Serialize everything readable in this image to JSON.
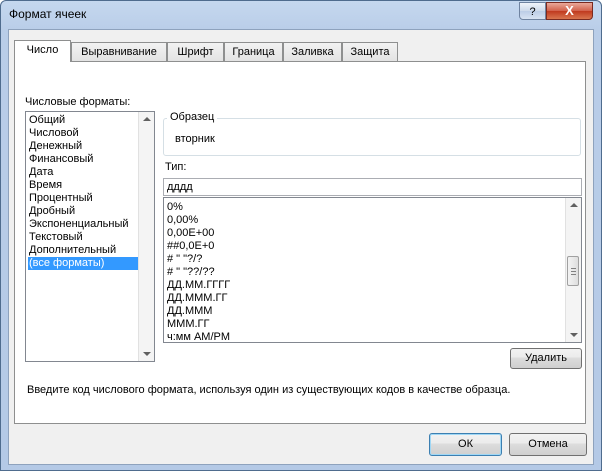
{
  "window": {
    "title": "Формат ячеек",
    "help_label": "?",
    "close_label": "X"
  },
  "tabs": [
    {
      "label": "Число",
      "active": true
    },
    {
      "label": "Выравнивание",
      "active": false
    },
    {
      "label": "Шрифт",
      "active": false
    },
    {
      "label": "Граница",
      "active": false
    },
    {
      "label": "Заливка",
      "active": false
    },
    {
      "label": "Защита",
      "active": false
    }
  ],
  "categories": {
    "label": "Числовые форматы:",
    "items": [
      "Общий",
      "Числовой",
      "Денежный",
      "Финансовый",
      "Дата",
      "Время",
      "Процентный",
      "Дробный",
      "Экспоненциальный",
      "Текстовый",
      "Дополнительный",
      "(все форматы)"
    ],
    "selected": "(все форматы)"
  },
  "sample": {
    "label": "Образец",
    "value": "вторник"
  },
  "type": {
    "label": "Тип:",
    "value": "дддд"
  },
  "formats": [
    "0%",
    "0,00%",
    "0,00E+00",
    "##0,0E+0",
    "# \" \"?/?",
    "# \" \"??/??",
    "ДД.ММ.ГГГГ",
    "ДД.МММ.ГГ",
    "ДД.МММ",
    "МММ.ГГ",
    "ч:мм AM/PM"
  ],
  "delete_button": "Удалить",
  "description": "Введите код числового формата, используя один из существующих кодов в качестве образца.",
  "ok_button": "ОК",
  "cancel_button": "Отмена"
}
